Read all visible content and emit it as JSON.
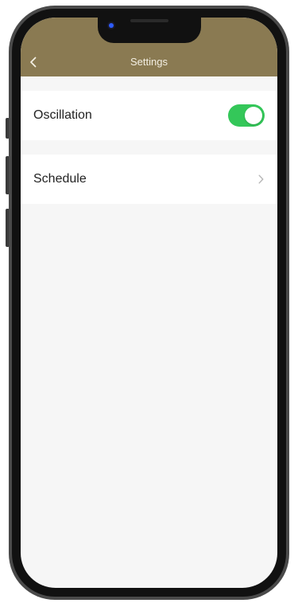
{
  "header": {
    "title": "Settings",
    "back_icon": "chevron-left-icon",
    "background_color": "#8a7a52"
  },
  "settings": {
    "oscillation": {
      "label": "Oscillation",
      "enabled": true,
      "toggle_color": "#34c759"
    },
    "schedule": {
      "label": "Schedule",
      "trailing_icon": "chevron-right-icon"
    }
  }
}
